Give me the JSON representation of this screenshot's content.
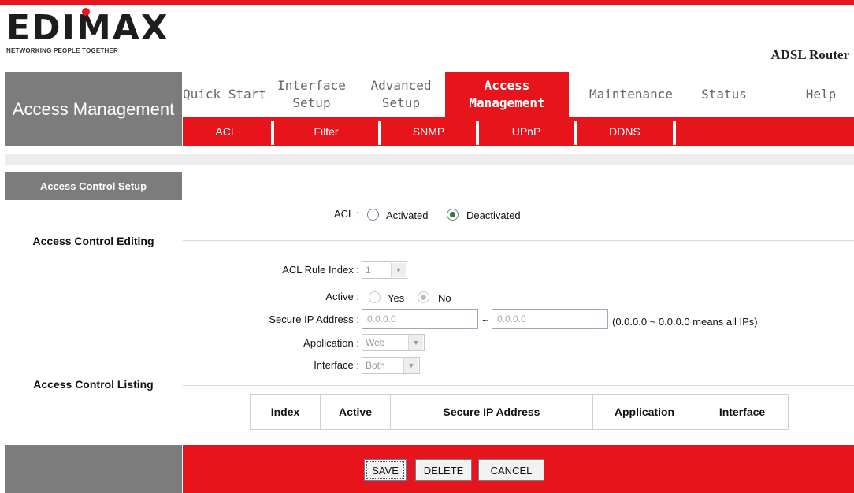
{
  "brand": {
    "logo_text": "EDIMAX",
    "tagline": "NETWORKING PEOPLE TOGETHER",
    "product": "ADSL Router"
  },
  "side_title": "Access Management",
  "nav": [
    {
      "label": "Quick Start",
      "active": false
    },
    {
      "label": "Interface Setup",
      "active": false
    },
    {
      "label": "Advanced Setup",
      "active": false
    },
    {
      "label": "Access Management",
      "active": true
    },
    {
      "label": "Maintenance",
      "active": false
    },
    {
      "label": "Status",
      "active": false
    },
    {
      "label": "Help",
      "active": false
    }
  ],
  "subnav": [
    "ACL",
    "Filter",
    "SNMP",
    "UPnP",
    "DDNS"
  ],
  "section": {
    "title": "Access Control Setup",
    "editing_label": "Access Control Editing",
    "listing_label": "Access Control Listing"
  },
  "acl": {
    "label": "ACL :",
    "options": [
      "Activated",
      "Deactivated"
    ],
    "selected": "Deactivated"
  },
  "form": {
    "rule_index_label": "ACL Rule Index :",
    "rule_index_value": "1",
    "active_label": "Active :",
    "active_options": [
      "Yes",
      "No"
    ],
    "active_selected": "No",
    "secure_ip_label": "Secure IP Address :",
    "ip_start": "0.0.0.0",
    "ip_sep": "~",
    "ip_end": "0.0.0.0",
    "ip_hint": "(0.0.0.0 ~ 0.0.0.0 means all IPs)",
    "application_label": "Application :",
    "application_value": "Web",
    "interface_label": "Interface :",
    "interface_value": "Both"
  },
  "table": {
    "headers": [
      "Index",
      "Active",
      "Secure IP Address",
      "Application",
      "Interface"
    ]
  },
  "buttons": {
    "save": "SAVE",
    "delete": "DELETE",
    "cancel": "CANCEL"
  },
  "colors": {
    "accent": "#e8141c",
    "sidebar_gray": "#7c7c7c"
  }
}
